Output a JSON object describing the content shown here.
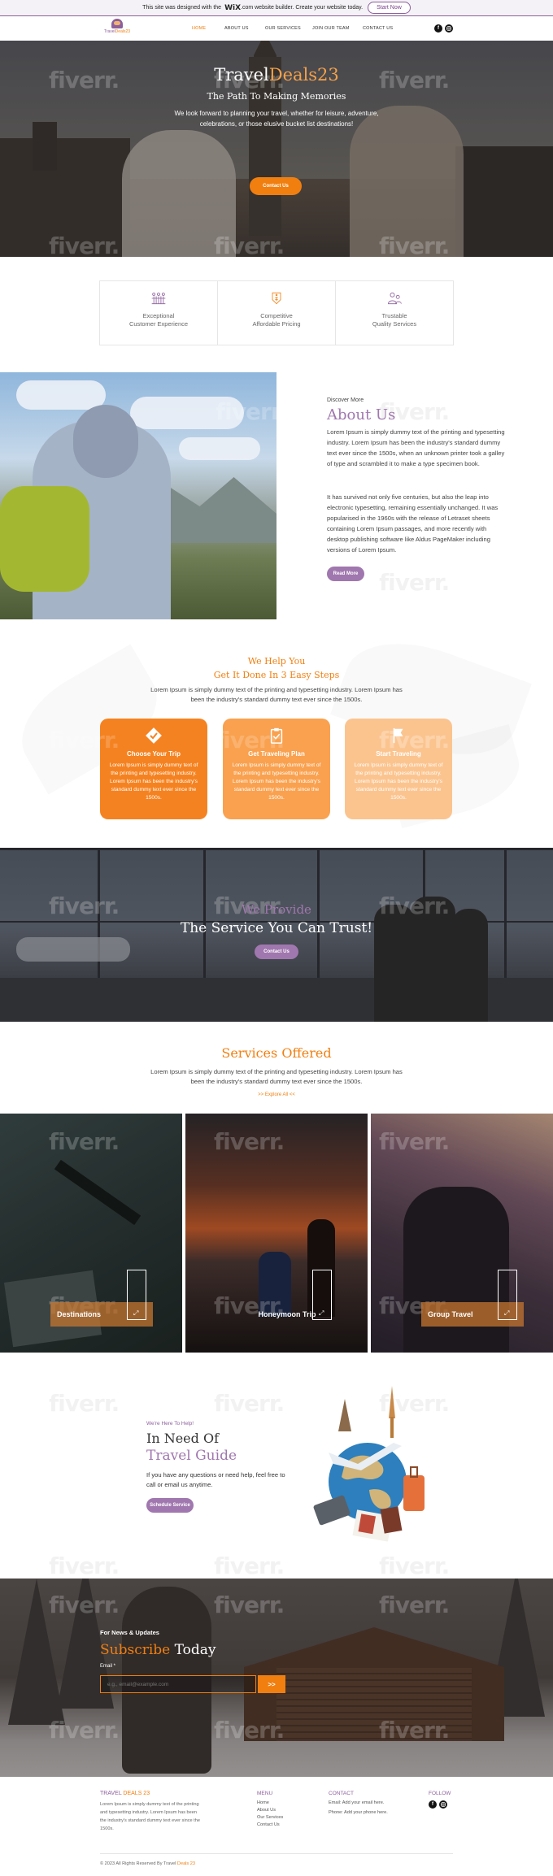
{
  "wix_banner": {
    "text_before": "This site was designed with the",
    "brand": "WiX",
    "text_after": ".com website builder. Create your website today.",
    "button": "Start Now"
  },
  "header": {
    "logo_text_a": "Travel",
    "logo_text_b": "Deals23",
    "nav": [
      "HOME",
      "ABOUT US",
      "OUR SERVICES",
      "JOIN OUR TEAM",
      "CONTACT US"
    ],
    "social_icons": [
      "facebook-icon",
      "instagram-icon"
    ]
  },
  "hero": {
    "title_a": "Travel",
    "title_b": "Deals23",
    "subtitle": "The Path To Making Memories",
    "description": "We look forward to planning your travel, whether for leisure, adventure, celebrations, or those elusive bucket list destinations!",
    "button": "Contact Us",
    "watermark": "fiverr."
  },
  "features": [
    {
      "icon": "users-grid-icon",
      "line1": "Exceptional",
      "line2": "Customer Experience"
    },
    {
      "icon": "price-tag-icon",
      "line1": "Competitive",
      "line2": "Affordable Pricing"
    },
    {
      "icon": "people-icon",
      "line1": "Trustable",
      "line2": "Quality Services"
    }
  ],
  "about": {
    "kicker": "Discover More",
    "title": "About Us",
    "p1": "Lorem Ipsum is simply dummy text of the printing and typesetting industry. Lorem Ipsum has been the industry's standard dummy text ever since the 1500s, when an unknown printer took a galley of type and scrambled it to make a type specimen book.",
    "p2": "It has survived not only five centuries, but also the leap into electronic typesetting, remaining essentially unchanged. It was popularised in the 1960s with the release of Letraset sheets containing Lorem Ipsum passages, and more recently with desktop publishing software like Aldus PageMaker including versions of Lorem Ipsum.",
    "button": "Read More"
  },
  "steps": {
    "title1": "We Help You",
    "title2": "Get It Done In 3 Easy Steps",
    "description": "Lorem Ipsum is simply dummy text of the printing and typesetting industry. Lorem Ipsum has been the industry's standard dummy text ever since the 1500s.",
    "items": [
      {
        "icon": "check-diamond-icon",
        "title": "Choose Your Trip",
        "text": "Lorem Ipsum is simply dummy text of the printing and typesetting industry. Lorem Ipsum has been the industry's standard dummy text ever since the 1500s.",
        "color": "#f58220"
      },
      {
        "icon": "clipboard-icon",
        "title": "Get Traveling Plan",
        "text": "Lorem Ipsum is simply dummy text of the printing and typesetting industry. Lorem Ipsum has been the industry's standard dummy text ever since the 1500s.",
        "color": "#f9a14f"
      },
      {
        "icon": "flag-icon",
        "title": "Start Traveling",
        "text": "Lorem Ipsum is simply dummy text of the printing and typesetting industry. Lorem Ipsum has been the industry's standard dummy text ever since the 1500s.",
        "color": "#fbc48f"
      }
    ]
  },
  "service_banner": {
    "title1": "We Provide",
    "title2": "The Service You Can Trust!",
    "button": "Contact Us"
  },
  "services": {
    "title": "Services Offered",
    "description": "Lorem Ipsum is simply dummy text of the printing and typesetting industry. Lorem Ipsum has been the industry's standard dummy text ever since the 1500s.",
    "link": ">> Explore All <<",
    "cards": [
      {
        "label": "Destinations"
      },
      {
        "label": "Honeymoon Trip"
      },
      {
        "label": "Group Travel"
      }
    ]
  },
  "travel_guide": {
    "kicker": "We're Here To Help!",
    "title1": "In Need Of",
    "title2": "Travel Guide",
    "description": "If you have any questions or need help, feel free to call or email us anytime.",
    "button": "Schedule Service"
  },
  "subscribe": {
    "kicker": "For News & Updates",
    "title_a": "Subscribe",
    "title_b": "Today",
    "email_label": "Email *",
    "email_placeholder": "e.g., email@example.com",
    "submit": ">>"
  },
  "footer": {
    "brand_a": "TRAVEL",
    "brand_b": "DEALS 23",
    "description": "Lorem Ipsum is simply dummy text of the printing and typesetting industry. Lorem Ipsum has been the industry's standard dummy text ever since the 1500s.",
    "menu_title": "MENU",
    "menu": [
      "Home",
      "About Us",
      "Our Services",
      "Contact Us"
    ],
    "contact_title": "CONTACT",
    "contact": [
      "Email: Add your email here.",
      "Phone: Add your phone here."
    ],
    "follow_title": "FOLLOW",
    "copyright_a": "© 2023 All Rights Reserved By Travel",
    "copyright_b": "Deals 23"
  }
}
